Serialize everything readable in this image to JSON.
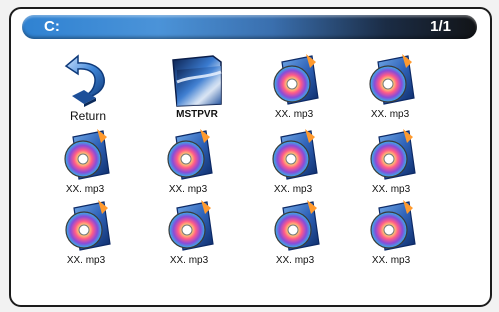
{
  "header": {
    "drive": "C:",
    "page": "1/1"
  },
  "colors": {
    "title_start": "#2f82d2",
    "title_end": "#121417",
    "frame": "#1c1c1c"
  },
  "items": [
    {
      "label": "Return",
      "icon": "return-arrow-icon"
    },
    {
      "label": "MSTPVR",
      "icon": "folder-icon"
    },
    {
      "label": "XX. mp3",
      "icon": "music-disc-icon"
    },
    {
      "label": "XX. mp3",
      "icon": "music-disc-icon"
    },
    {
      "label": "XX. mp3",
      "icon": "music-disc-icon"
    },
    {
      "label": "XX. mp3",
      "icon": "music-disc-icon"
    },
    {
      "label": "XX. mp3",
      "icon": "music-disc-icon"
    },
    {
      "label": "XX. mp3",
      "icon": "music-disc-icon"
    },
    {
      "label": "XX. mp3",
      "icon": "music-disc-icon"
    },
    {
      "label": "XX. mp3",
      "icon": "music-disc-icon"
    },
    {
      "label": "XX. mp3",
      "icon": "music-disc-icon"
    },
    {
      "label": "XX. mp3",
      "icon": "music-disc-icon"
    }
  ]
}
